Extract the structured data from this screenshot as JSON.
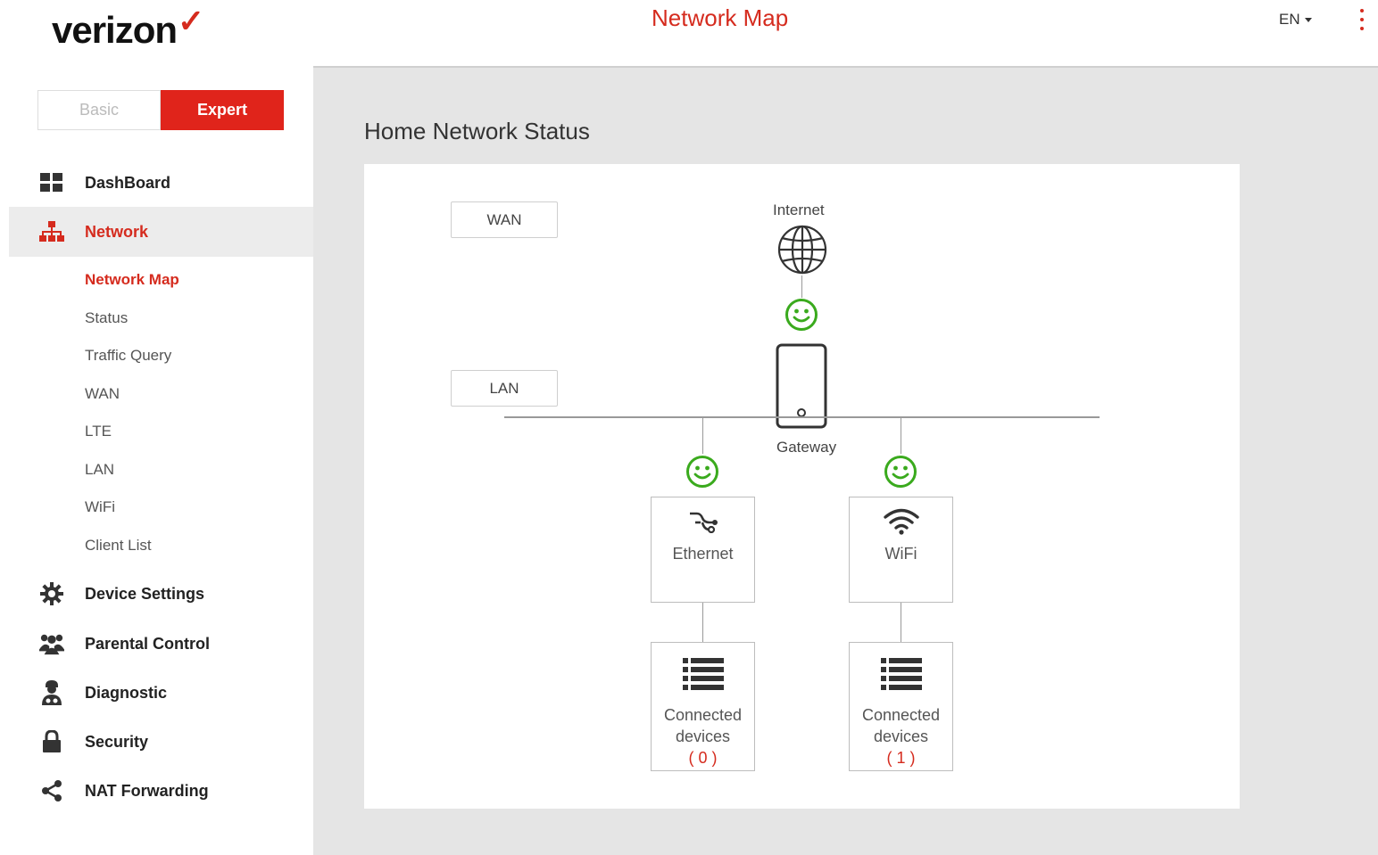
{
  "header": {
    "logo_text": "verizon",
    "page_title": "Network Map",
    "language": "EN"
  },
  "mode": {
    "basic_label": "Basic",
    "expert_label": "Expert"
  },
  "sidebar": {
    "items": [
      {
        "label": "DashBoard",
        "icon": "dashboard-icon"
      },
      {
        "label": "Network",
        "icon": "network-icon"
      },
      {
        "label": "Device Settings",
        "icon": "gear-icon"
      },
      {
        "label": "Parental Control",
        "icon": "users-icon"
      },
      {
        "label": "Diagnostic",
        "icon": "doctor-icon"
      },
      {
        "label": "Security",
        "icon": "lock-icon"
      },
      {
        "label": "NAT Forwarding",
        "icon": "share-icon"
      }
    ],
    "network_sub": [
      "Network Map",
      "Status",
      "Traffic Query",
      "WAN",
      "LTE",
      "LAN",
      "WiFi",
      "Client List"
    ]
  },
  "main": {
    "title": "Home Network Status",
    "wan_label": "WAN",
    "lan_label": "LAN",
    "internet_label": "Internet",
    "gateway_label": "Gateway",
    "ethernet_label": "Ethernet",
    "wifi_label": "WiFi",
    "connected_line1": "Connected",
    "connected_line2": "devices",
    "ethernet_count": "( 0 )",
    "wifi_count": "( 1 )"
  },
  "colors": {
    "accent": "#d52b1e",
    "status_ok": "#3aaa1d"
  }
}
